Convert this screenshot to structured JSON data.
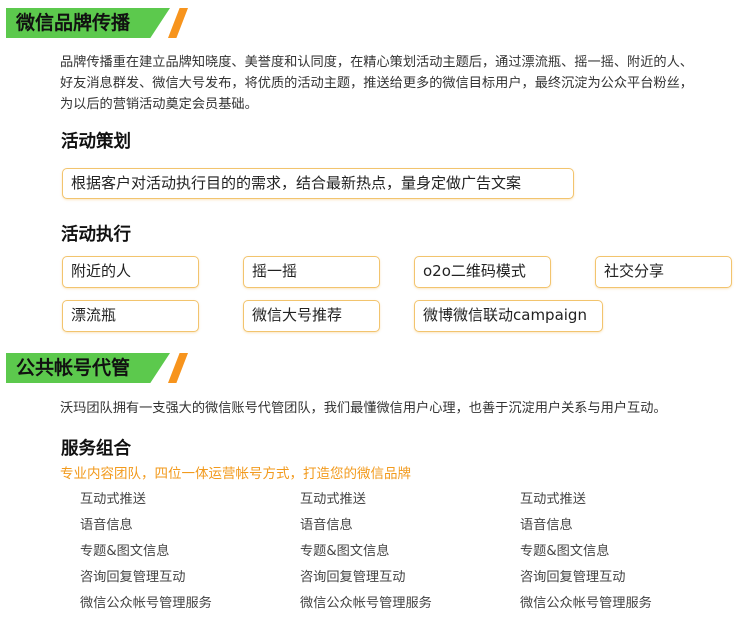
{
  "section1": {
    "title": "微信品牌传播",
    "intro_lines": [
      "品牌传播重在建立品牌知晓度、美誉度和认同度，在精心策划活动主题后，通过漂流瓶、摇一摇、附近的人、",
      "好友消息群发、微信大号发布，将优质的活动主题，推送给更多的微信目标用户，最终沉淀为公众平台粉丝，",
      "为以后的营销活动奠定会员基础。"
    ],
    "planning": {
      "heading": "活动策划",
      "box_text": "根据客户对活动执行目的的需求，结合最新热点，量身定做广告文案"
    },
    "execution": {
      "heading": "活动执行",
      "items": [
        "附近的人",
        "摇一摇",
        "o2o二维码模式",
        "社交分享",
        "漂流瓶",
        "微信大号推荐",
        "微博微信联动campaign"
      ]
    }
  },
  "section2": {
    "title": "公共帐号代管",
    "intro": "沃玛团队拥有一支强大的微信账号代管团队，我们最懂微信用户心理，也善于沉淀用户关系与用户互动。",
    "services": {
      "heading": "服务组合",
      "subtitle": "专业内容团队，四位一体运营帐号方式，打造您的微信品牌",
      "columns": [
        [
          "互动式推送",
          "语音信息",
          "专题&图文信息",
          "咨询回复管理互动",
          "微信公众帐号管理服务"
        ],
        [
          "互动式推送",
          "语音信息",
          "专题&图文信息",
          "咨询回复管理互动",
          "微信公众帐号管理服务"
        ],
        [
          "互动式推送",
          "语音信息",
          "专题&图文信息",
          "咨询回复管理互动",
          "微信公众帐号管理服务"
        ]
      ]
    }
  },
  "colors": {
    "banner_green": "#5cc94d",
    "banner_orange": "#f7941d",
    "subtitle_orange": "#f29a1d",
    "box_border": "#f2c46e"
  }
}
